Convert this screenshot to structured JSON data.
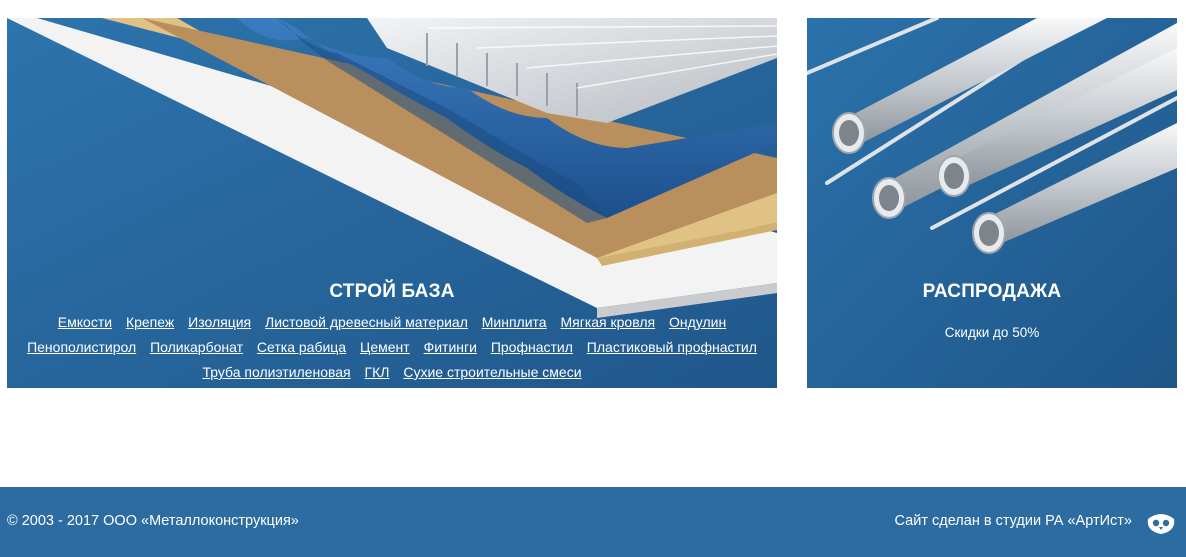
{
  "main_card": {
    "title": "СТРОЙ БАЗА",
    "links": [
      "Емкости",
      "Крепеж",
      "Изоляция",
      "Листовой древесный материал",
      "Минплита",
      "Мягкая кровля",
      "Ондулин",
      "Пенополистирол",
      "Поликарбонат",
      "Сетка рабица",
      "Цемент",
      "Фитинги",
      "Профнастил",
      "Пластиковый профнастил",
      "Труба полиэтиленовая",
      "ГКЛ",
      "Сухие строительные смеси"
    ]
  },
  "sale_card": {
    "title": "РАСПРОДАЖА",
    "subtitle": "Скидки до 50%"
  },
  "footer": {
    "copyright": "© 2003 - 2017 ООО «Металлоконструкция»",
    "studio": "Сайт сделан в студии РА «АртИст»"
  },
  "colors": {
    "card_blue": "#2a6aa1",
    "footer_blue": "#2d6ca0",
    "text": "#ffffff"
  },
  "icons": {
    "studio_logo": "owl-face-icon"
  }
}
